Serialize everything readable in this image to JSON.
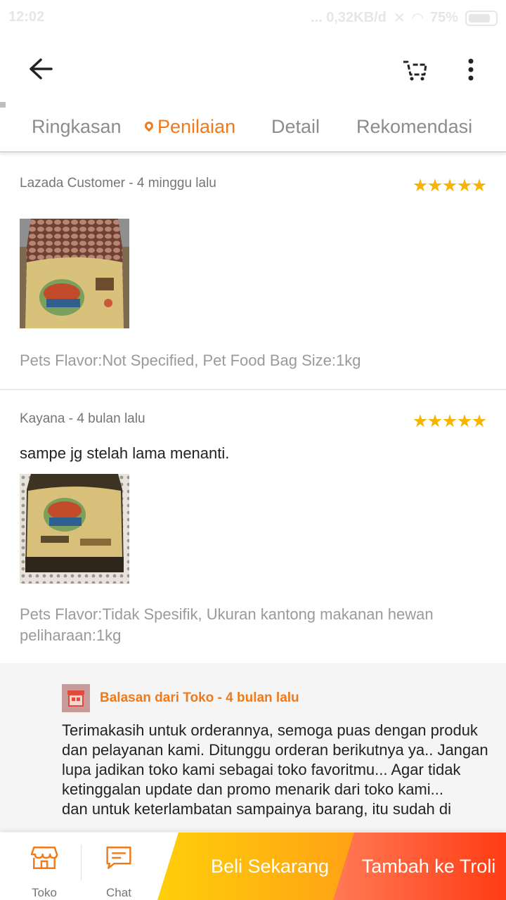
{
  "status_bar": {
    "time": "12:02",
    "network": "... 0,32KB/d",
    "battery": "75%"
  },
  "header": {
    "back_icon": "arrow-left-icon",
    "cart_icon": "cart-icon",
    "more_icon": "more-vertical-icon"
  },
  "tabs": [
    {
      "label": "Ringkasan",
      "active": false
    },
    {
      "label": "Penilaian",
      "active": true
    },
    {
      "label": "Detail",
      "active": false
    },
    {
      "label": "Rekomendasi",
      "active": false
    }
  ],
  "reviews": [
    {
      "author": "Lazada Customer - 4 minggu lalu",
      "rating": 5,
      "text": "",
      "photo": "product-photo-caesar-jar",
      "variant": "Pets Flavor:Not Specified, Pet Food Bag Size:1kg"
    },
    {
      "author": "Kayana - 4 bulan lalu",
      "rating": 5,
      "text": "sampe jg stelah lama menanti.",
      "photo": "product-photo-caesar-jar-on-doily",
      "variant": "Pets Flavor:Tidak Spesifik, Ukuran kantong makanan hewan peliharaan:1kg"
    }
  ],
  "seller_reply": {
    "avatar_icon": "store-icon",
    "heading": "Balasan dari Toko - 4 bulan lalu",
    "text": "Terimakasih untuk orderannya, semoga puas dengan produk dan pelayanan kami. Ditunggu orderan berikutnya ya.. Jangan lupa jadikan toko kami sebagai toko favoritmu... Agar tidak ketinggalan update dan promo menarik dari toko kami...\ndan untuk keterlambatan sampainya barang, itu sudah di"
  },
  "bottom_bar": {
    "store_label": "Toko",
    "chat_label": "Chat",
    "buy_now_label": "Beli Sekarang",
    "add_to_cart_label": "Tambah ke Troli"
  },
  "colors": {
    "accent": "#f07a1a",
    "star": "#f8b400",
    "buy_now": "#ffb70f",
    "add_to_cart": "#ff4b24"
  }
}
